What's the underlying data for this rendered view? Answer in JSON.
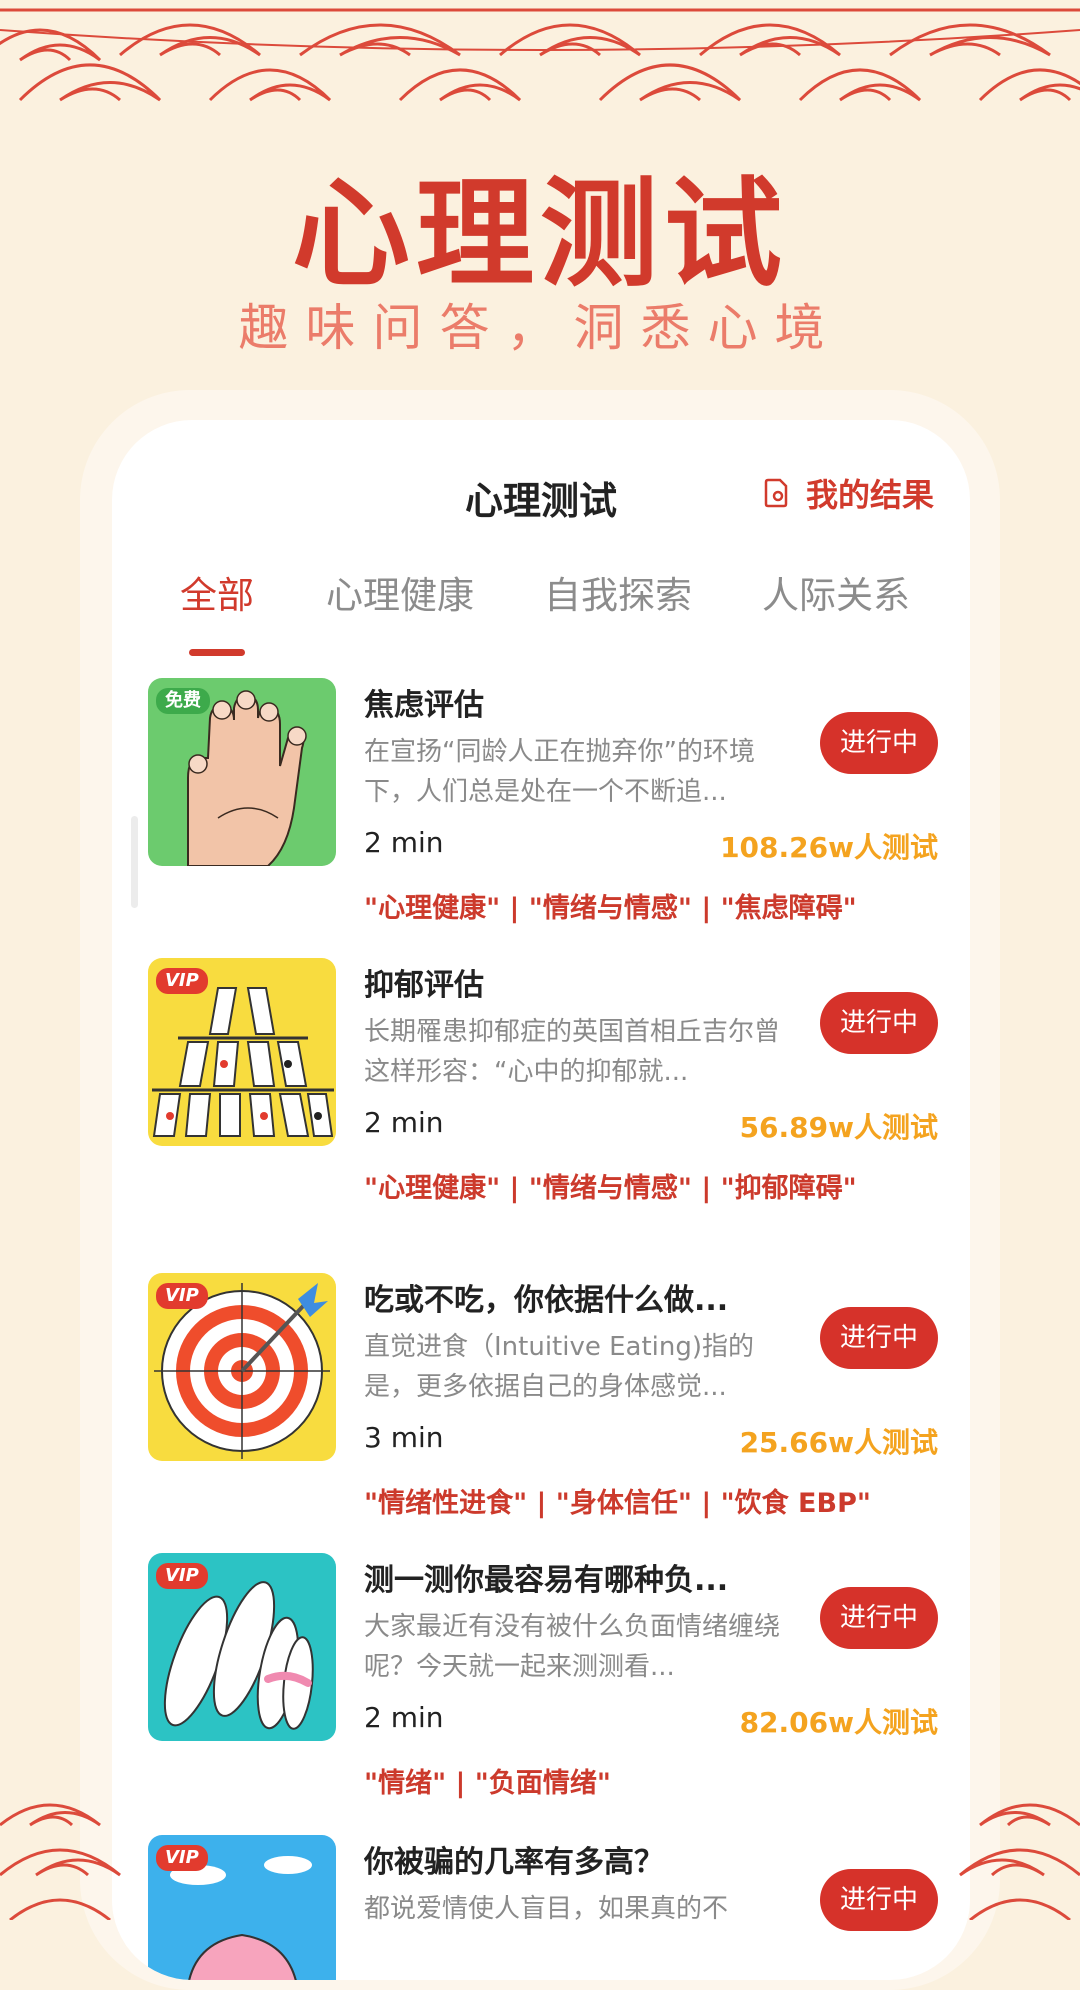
{
  "header": {
    "title": "心理测试",
    "subtitle": "趣味问答，洞悉心境"
  },
  "card": {
    "title": "心理测试",
    "my_results_label": "我的结果"
  },
  "tabs": [
    {
      "label": "全部",
      "active": true
    },
    {
      "label": "心理健康",
      "active": false
    },
    {
      "label": "自我探索",
      "active": false
    },
    {
      "label": "人际关系",
      "active": false
    }
  ],
  "tests": [
    {
      "title": "焦虑评估",
      "description": "在宣扬“同龄人正在抛弃你”的环境下，人们总是处在一个不断追...",
      "duration": "2 min",
      "count": "108.26w人测试",
      "status": "进行中",
      "tags": "\"心理健康\" | \"情绪与情感\" | \"焦虑障碍\"",
      "badge": "免费",
      "icon": "hand-icon"
    },
    {
      "title": "抑郁评估",
      "description": "长期罹患抑郁症的英国首相丘吉尔曾这样形容：“心中的抑郁就...",
      "duration": "2 min",
      "count": "56.89w人测试",
      "status": "进行中",
      "tags": "\"心理健康\" | \"情绪与情感\" | \"抑郁障碍\"",
      "badge": "VIP",
      "icon": "card-house-icon"
    },
    {
      "title": "吃或不吃，你依据什么做...",
      "description": "直觉进食（Intuitive Eating)指的是，更多依据自己的身体感觉...",
      "duration": "3 min",
      "count": "25.66w人测试",
      "status": "进行中",
      "tags": "\"情绪性进食\" | \"身体信任\" | \"饮食 EBP\"",
      "badge": "VIP",
      "icon": "target-icon"
    },
    {
      "title": "测一测你最容易有哪种负...",
      "description": "大家最近有没有被什么负面情绪缠绕呢？今天就一起来测测看...",
      "duration": "2 min",
      "count": "82.06w人测试",
      "status": "进行中",
      "tags": "\"情绪\" | \"负面情绪\"",
      "badge": "VIP",
      "icon": "clocks-icon"
    },
    {
      "title": "你被骗的几率有多高？",
      "description": "都说爱情使人盲目，如果真的不",
      "status": "进行中",
      "badge": "VIP",
      "icon": "brain-icon"
    }
  ],
  "colors": {
    "accent": "#d13a2c",
    "background": "#fbf1df",
    "count": "#f4a31f"
  }
}
